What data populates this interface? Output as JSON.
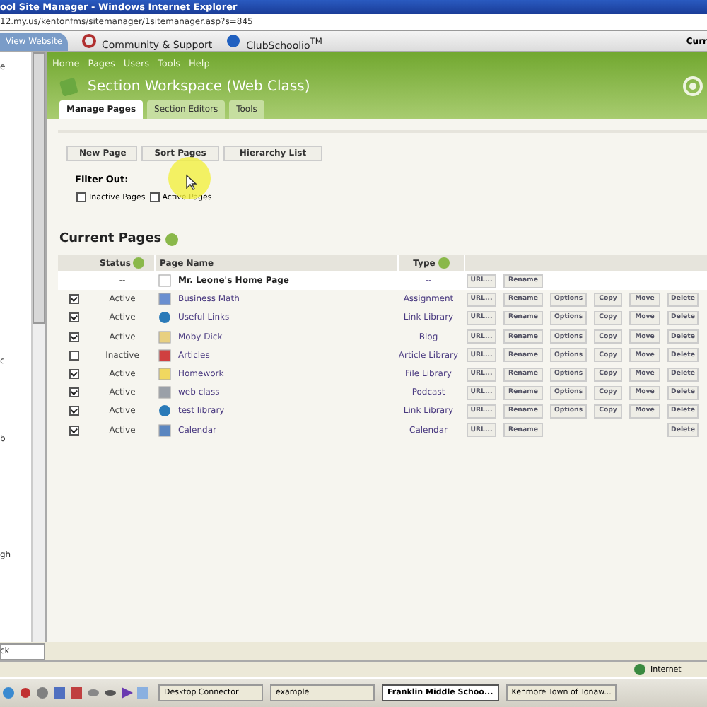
{
  "window": {
    "title": "ool Site Manager - Windows Internet Explorer",
    "address": "12.my.us/kentonfms/sitemanager/1sitemanager.asp?s=845"
  },
  "toolbar": {
    "items": [
      {
        "label": "View Website",
        "kind": "tab"
      },
      {
        "label": "Community & Support",
        "kind": "community"
      },
      {
        "label": "ClubSchoolio$^{TM}$",
        "kind": "club"
      }
    ],
    "right_text": "Curr"
  },
  "sidebar": {
    "fragments": [
      "e",
      "c",
      "b",
      "gh",
      "ck"
    ]
  },
  "nav": [
    "Home",
    "Pages",
    "Users",
    "Tools",
    "Help"
  ],
  "workspace_title": "Section Workspace (Web Class)",
  "tabs": [
    {
      "label": "Manage Pages",
      "selected": true
    },
    {
      "label": "Section Editors",
      "selected": false
    },
    {
      "label": "Tools",
      "selected": false
    }
  ],
  "buttons": [
    "New Page",
    "Sort Pages",
    "Hierarchy List"
  ],
  "filter": {
    "label": "Filter Out:",
    "options": [
      {
        "label": "Inactive Pages",
        "checked": false
      },
      {
        "label": "Active Pages",
        "checked": false
      }
    ]
  },
  "section_title": "Current Pages",
  "table": {
    "columns": [
      "Status",
      "Page Name",
      "Type"
    ],
    "rows": [
      {
        "status": "--",
        "name": "Mr. Leone's Home Page",
        "type": "--",
        "kind": "home",
        "actions": [
          {
            "label": "URL...",
            "kind": "url"
          },
          {
            "label": "Rename",
            "kind": "rename"
          }
        ]
      },
      {
        "checked": true,
        "status": "Active",
        "name": "Business Math",
        "type": "Assignment",
        "kind": "assignment",
        "actions": [
          {
            "label": "URL...",
            "kind": "url"
          },
          {
            "label": "Rename",
            "kind": "rename"
          },
          {
            "label": "Options",
            "kind": "options"
          },
          {
            "label": "Copy",
            "kind": "copy"
          },
          {
            "label": "Move",
            "kind": "move"
          },
          {
            "label": "Delete",
            "kind": "delete"
          }
        ]
      },
      {
        "checked": true,
        "status": "Active",
        "name": "Useful Links",
        "type": "Link Library",
        "kind": "link",
        "actions": [
          {
            "label": "URL...",
            "kind": "url"
          },
          {
            "label": "Rename",
            "kind": "rename"
          },
          {
            "label": "Options",
            "kind": "options"
          },
          {
            "label": "Copy",
            "kind": "copy"
          },
          {
            "label": "Move",
            "kind": "move"
          },
          {
            "label": "Delete",
            "kind": "delete"
          }
        ]
      },
      {
        "checked": true,
        "status": "Active",
        "name": "Moby Dick",
        "type": "Blog",
        "kind": "blog",
        "actions": [
          {
            "label": "URL...",
            "kind": "url"
          },
          {
            "label": "Rename",
            "kind": "rename"
          },
          {
            "label": "Options",
            "kind": "options"
          },
          {
            "label": "Copy",
            "kind": "copy"
          },
          {
            "label": "Move",
            "kind": "move"
          },
          {
            "label": "Delete",
            "kind": "delete"
          }
        ]
      },
      {
        "checked": false,
        "status": "Inactive",
        "name": "Articles",
        "type": "Article Library",
        "kind": "article",
        "actions": [
          {
            "label": "URL...",
            "kind": "url"
          },
          {
            "label": "Rename",
            "kind": "rename"
          },
          {
            "label": "Options",
            "kind": "options"
          },
          {
            "label": "Copy",
            "kind": "copy"
          },
          {
            "label": "Move",
            "kind": "move"
          },
          {
            "label": "Delete",
            "kind": "delete"
          }
        ]
      },
      {
        "checked": true,
        "status": "Active",
        "name": "Homework",
        "type": "File Library",
        "kind": "folder",
        "actions": [
          {
            "label": "URL...",
            "kind": "url"
          },
          {
            "label": "Rename",
            "kind": "rename"
          },
          {
            "label": "Options",
            "kind": "options"
          },
          {
            "label": "Copy",
            "kind": "copy"
          },
          {
            "label": "Move",
            "kind": "move"
          },
          {
            "label": "Delete",
            "kind": "delete"
          }
        ]
      },
      {
        "checked": true,
        "status": "Active",
        "name": "web class",
        "type": "Podcast",
        "kind": "podcast",
        "actions": [
          {
            "label": "URL...",
            "kind": "url"
          },
          {
            "label": "Rename",
            "kind": "rename"
          },
          {
            "label": "Options",
            "kind": "options"
          },
          {
            "label": "Copy",
            "kind": "copy"
          },
          {
            "label": "Move",
            "kind": "move"
          },
          {
            "label": "Delete",
            "kind": "delete"
          }
        ]
      },
      {
        "checked": true,
        "status": "Active",
        "name": "test library",
        "type": "Link Library",
        "kind": "link",
        "actions": [
          {
            "label": "URL...",
            "kind": "url"
          },
          {
            "label": "Rename",
            "kind": "rename"
          },
          {
            "label": "Options",
            "kind": "options"
          },
          {
            "label": "Copy",
            "kind": "copy"
          },
          {
            "label": "Move",
            "kind": "move"
          },
          {
            "label": "Delete",
            "kind": "delete"
          }
        ]
      },
      {
        "checked": true,
        "status": "Active",
        "name": "Calendar",
        "type": "Calendar",
        "kind": "calendar",
        "actions": [
          {
            "label": "URL...",
            "kind": "url"
          },
          {
            "label": "Rename",
            "kind": "rename"
          },
          {
            "label": "Delete",
            "kind": "delete"
          }
        ]
      }
    ]
  },
  "status_bar": {
    "zone": "Internet"
  },
  "taskbar": [
    {
      "label": "Desktop Connector",
      "selected": false
    },
    {
      "label": "example",
      "selected": false
    },
    {
      "label": "Franklin Middle Schoo...",
      "selected": true
    },
    {
      "label": "Kenmore Town of Tonaw...",
      "selected": false
    }
  ]
}
